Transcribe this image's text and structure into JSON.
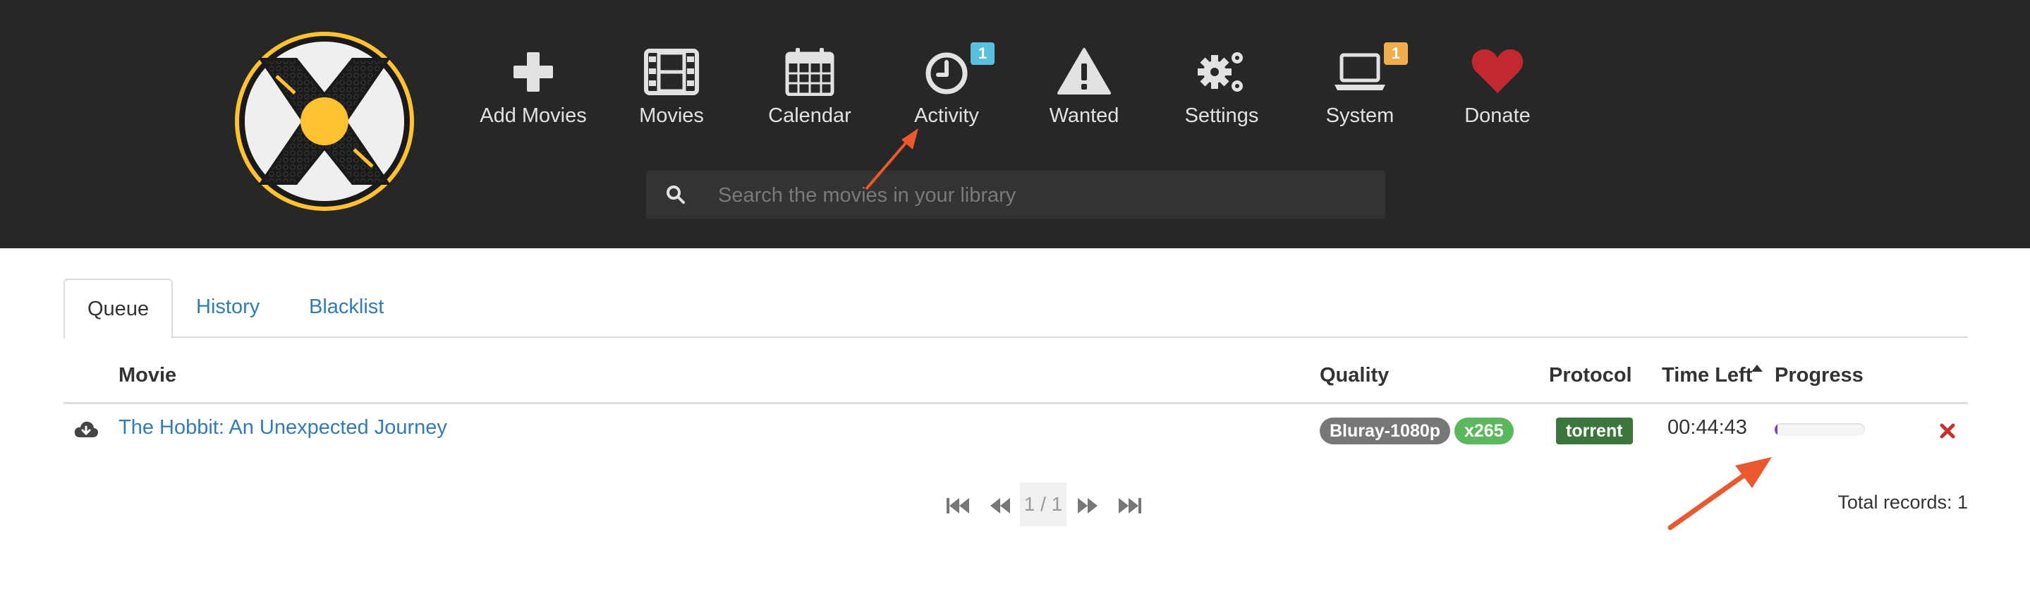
{
  "nav": {
    "items": [
      {
        "label": "Add Movies",
        "icon": "plus-icon"
      },
      {
        "label": "Movies",
        "icon": "film-icon"
      },
      {
        "label": "Calendar",
        "icon": "calendar-icon"
      },
      {
        "label": "Activity",
        "icon": "clock-icon",
        "badge": "1",
        "badge_color": "#5bc0de"
      },
      {
        "label": "Wanted",
        "icon": "warning-icon"
      },
      {
        "label": "Settings",
        "icon": "cogs-icon"
      },
      {
        "label": "System",
        "icon": "laptop-icon",
        "badge": "1",
        "badge_color": "#f0ad4e"
      },
      {
        "label": "Donate",
        "icon": "heart-icon"
      }
    ]
  },
  "search": {
    "placeholder": "Search the movies in your library",
    "value": ""
  },
  "tabs": [
    {
      "label": "Queue",
      "active": true
    },
    {
      "label": "History",
      "active": false
    },
    {
      "label": "Blacklist",
      "active": false
    }
  ],
  "table": {
    "columns": [
      "Movie",
      "Quality",
      "Protocol",
      "Time Left",
      "Progress"
    ],
    "sort_column": "Time Left",
    "rows": [
      {
        "status_icon": "download-icon",
        "movie": "The Hobbit: An Unexpected Journey",
        "quality": "Bluray-1080p",
        "codec": "x265",
        "protocol": "torrent",
        "time_left": "00:44:43",
        "progress": 0.03,
        "remove_icon": "close-icon"
      }
    ]
  },
  "pager": {
    "page_text": "1 / 1"
  },
  "total_records": "Total records: 1",
  "colors": {
    "header_bg": "#272727",
    "link": "#337ab7",
    "quality_label": "#777777",
    "codec_label": "#5cb85c",
    "protocol_label": "#3c763d",
    "remove": "#c9302c",
    "progress_bar": "#7a43b6",
    "logo_accent": "#ffc230",
    "donate_heart": "#c1292f",
    "annotation_arrow": "#e9582f"
  }
}
